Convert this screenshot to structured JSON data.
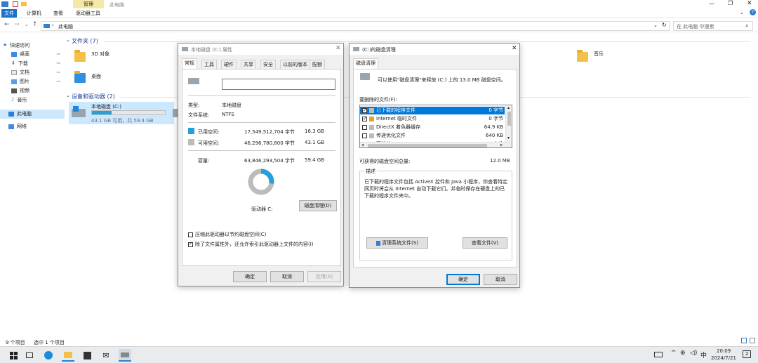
{
  "explorer": {
    "window_title": "此电脑",
    "context_tab": "管理",
    "tabs": [
      "文件",
      "计算机",
      "查看",
      "驱动器工具"
    ],
    "address": "此电脑",
    "search_placeholder": "在 此电脑 中搜索",
    "nav": {
      "quick_access": "快速访问",
      "items": [
        "桌面",
        "下载",
        "文档",
        "图片",
        "视频",
        "音乐"
      ],
      "this_pc": "此电脑",
      "network": "网络"
    },
    "folders_header": "文件夹 (7)",
    "folders": [
      "3D 对象",
      "桌面",
      "音乐"
    ],
    "devices_header": "设备和驱动器 (2)",
    "drive": {
      "name": "本地磁盘 (C:)",
      "free_text": "43.1 GB 可用，共 59.4 GB",
      "used_fraction": 0.27
    },
    "status": {
      "items": "9 个项目",
      "selected": "选中 1 个项目"
    }
  },
  "props_dialog": {
    "title": "本地磁盘 (C:) 属性",
    "tabs": [
      "常规",
      "工具",
      "硬件",
      "共享",
      "安全",
      "以前的版本",
      "配额"
    ],
    "name_value": "",
    "type_label": "类型:",
    "type_value": "本地磁盘",
    "fs_label": "文件系统:",
    "fs_value": "NTFS",
    "used_label": "已用空间:",
    "used_bytes": "17,549,512,704 字节",
    "used_gb": "16.3 GB",
    "free_label": "可用空间:",
    "free_bytes": "46,296,780,800 字节",
    "free_gb": "43.1 GB",
    "cap_label": "容量:",
    "cap_bytes": "63,846,293,504 字节",
    "cap_gb": "59.4 GB",
    "used_fraction": 0.275,
    "drive_label": "驱动器 C:",
    "cleanup_btn": "磁盘清理(D)",
    "compress_label": "压缩此驱动器以节约磁盘空间(C)",
    "compress_checked": false,
    "index_label": "除了文件属性外，还允许索引此驱动器上文件的内容(I)",
    "index_checked": true,
    "ok": "确定",
    "cancel": "取消",
    "apply": "应用(A)",
    "colors": {
      "used": "#26a0da",
      "free": "#bcbcbc"
    }
  },
  "cleanup_dialog": {
    "title": "(C:)的磁盘清理",
    "tab": "磁盘清理",
    "intro": "可以使用\"磁盘清理\"来释放 (C:) 上的 13.0 MB 磁盘空间。",
    "files_label": "要删除的文件(F):",
    "files": [
      {
        "name": "已下载的程序文件",
        "size": "0 字节",
        "checked": true,
        "selected": true
      },
      {
        "name": "Internet 临时文件",
        "size": "0 字节",
        "checked": true,
        "selected": false
      },
      {
        "name": "DirectX 着色器缓存",
        "size": "64.9 KB",
        "checked": false,
        "selected": false
      },
      {
        "name": "传递优化文件",
        "size": "640 KB",
        "checked": false,
        "selected": false
      },
      {
        "name": "回收站",
        "size": "0 字节",
        "checked": false,
        "selected": false
      }
    ],
    "total_label": "可获得的磁盘空间总量:",
    "total_value": "12.0 MB",
    "desc_label": "描述",
    "desc_text": "已下载的程序文件包括 ActiveX 控件和 Java 小程序，你查看特定网页时将会从 Internet 自动下载它们。并临时保存在硬盘上的已下载的程序文件夹中。",
    "clean_system_btn": "清理系统文件(S)",
    "view_files_btn": "查看文件(V)",
    "ok": "确定",
    "cancel": "取消"
  },
  "taskbar": {
    "ime": "中",
    "time": "20:09",
    "date": "2024/7/21",
    "notif_count": "2"
  }
}
